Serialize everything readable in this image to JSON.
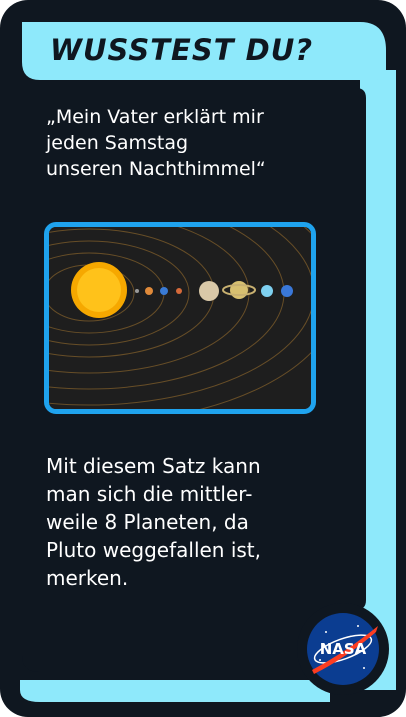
{
  "card": {
    "title": "WUSSTEST DU?",
    "quote": "„Mein Vater erklärt mir\njeden Samstag\nunseren Nachthimmel“",
    "body": "Mit diesem Satz kann\nman sich die mittler-\nweile 8 Planeten, da\nPluto weggefallen ist,\nmerken.",
    "logo_text": "NASA"
  },
  "colors": {
    "frame_accent": "#8ee9fb",
    "card_background": "#0f1720",
    "image_border": "#1fa3ee",
    "logo_blue": "#0b3d91",
    "logo_red": "#fc3d21"
  }
}
